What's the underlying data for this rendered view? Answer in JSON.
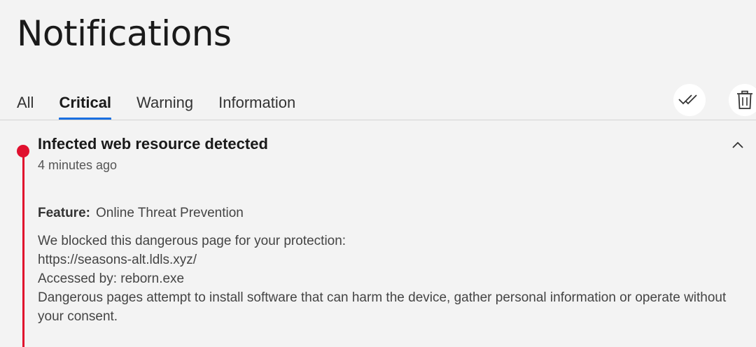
{
  "page": {
    "title": "Notifications"
  },
  "tabs": [
    {
      "label": "All",
      "active": false
    },
    {
      "label": "Critical",
      "active": true
    },
    {
      "label": "Warning",
      "active": false
    },
    {
      "label": "Information",
      "active": false
    }
  ],
  "toolbar": {
    "mark_all_read_icon": "double-check-icon",
    "delete_icon": "trash-icon"
  },
  "colors": {
    "accent": "#1a6fe0",
    "critical": "#e0102e",
    "background": "#f3f3f3"
  },
  "notification": {
    "title": "Infected web resource detected",
    "time": "4 minutes ago",
    "feature_label": "Feature:",
    "feature_value": "Online Threat Prevention",
    "lines": [
      "We blocked this dangerous page for your protection:",
      "https://seasons-alt.ldls.xyz/",
      "Accessed by: reborn.exe",
      "Dangerous pages attempt to install software that can harm the device, gather personal information or operate without your consent."
    ]
  }
}
